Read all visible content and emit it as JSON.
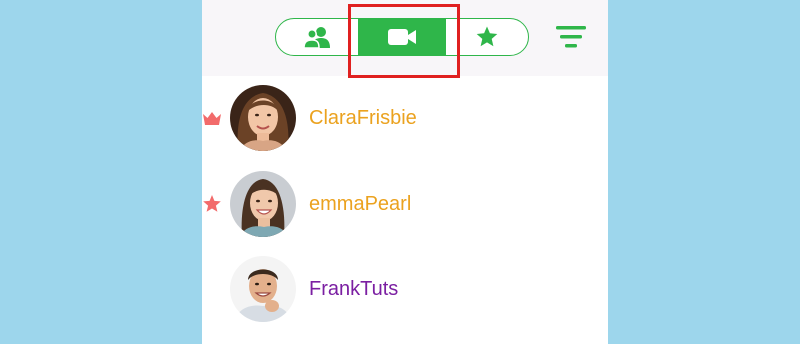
{
  "tabs": [
    {
      "icon": "contacts-icon",
      "selected": false
    },
    {
      "icon": "video-camera-icon",
      "selected": true
    },
    {
      "icon": "star-icon",
      "selected": false
    }
  ],
  "filter": {
    "icon": "filter-menu-icon"
  },
  "colors": {
    "accent": "#2fb64a",
    "highlight": "#e02020",
    "badge": "#f26b6b",
    "name_gold": "#eba21f",
    "name_purple": "#7b1fa2",
    "backdrop": "#9dd6ec"
  },
  "contacts": [
    {
      "name": "ClaraFrisbie",
      "badge": "crown-icon"
    },
    {
      "name": "emmaPearl",
      "badge": "star-icon"
    },
    {
      "name": "FrankTuts",
      "badge": null
    }
  ]
}
